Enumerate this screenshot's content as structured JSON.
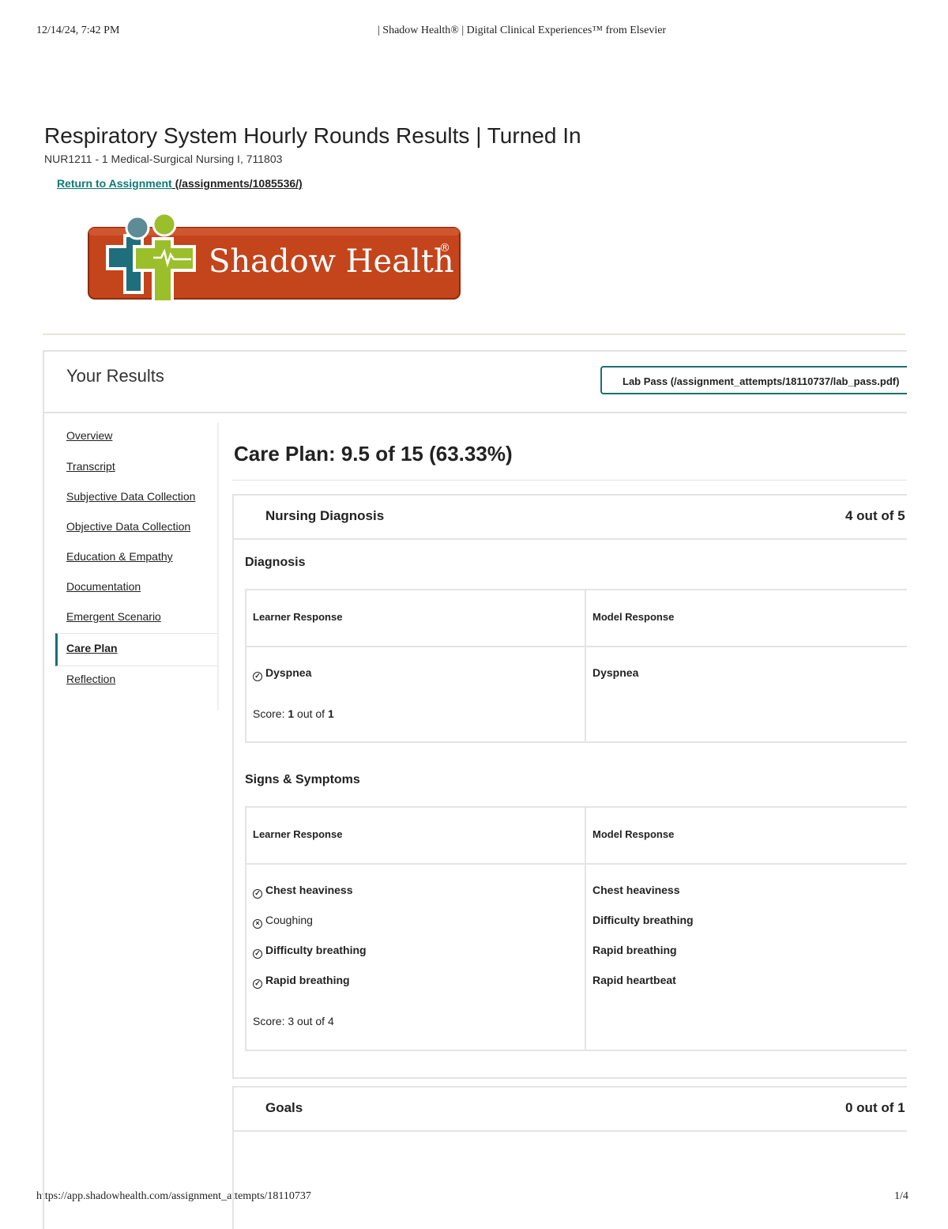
{
  "print_header": {
    "datetime": "12/14/24, 7:42 PM",
    "title": "| Shadow Health® | Digital Clinical Experiences™ from Elsevier"
  },
  "print_footer": {
    "url": "https://app.shadowhealth.com/assignment_attempts/18110737",
    "page": "1/4"
  },
  "page": {
    "title": "Respiratory System Hourly Rounds Results | Turned In",
    "course": "NUR1211 - 1 Medical-Surgical Nursing I, 711803",
    "return_label": "Return to Assignment",
    "return_path": " (/assignments/1085536/)"
  },
  "logo": {
    "text": "Shadow Health",
    "reg": "®",
    "colors": {
      "bg": "#c4441c",
      "figure_green": "#9bbf2a",
      "figure_teal": "#1f6e7c"
    }
  },
  "results": {
    "title": "Your Results",
    "lab_pass": "Lab Pass (/assignment_attempts/18110737/lab_pass.pdf)"
  },
  "sidebar": {
    "items": [
      {
        "label": "Overview",
        "active": false
      },
      {
        "label": "Transcript",
        "active": false
      },
      {
        "label": "Subjective Data Collection",
        "active": false
      },
      {
        "label": "Objective Data Collection",
        "active": false
      },
      {
        "label": "Education & Empathy",
        "active": false
      },
      {
        "label": "Documentation",
        "active": false
      },
      {
        "label": "Emergent Scenario",
        "active": false
      },
      {
        "label": "Care Plan",
        "active": true
      },
      {
        "label": "Reflection",
        "active": false
      }
    ]
  },
  "main": {
    "title": "Care Plan: 9.5 of 15 (63.33%)",
    "nursing_diagnosis": {
      "title": "Nursing Diagnosis",
      "score": "4 out of 5",
      "diagnosis": {
        "title": "Diagnosis",
        "learner_header": "Learner Response",
        "model_header": "Model Response",
        "learner": [
          {
            "text": "Dyspnea",
            "mark": "check"
          }
        ],
        "model": [
          "Dyspnea"
        ],
        "score_prefix": "Score: ",
        "score_value": "1",
        "score_mid": " out of ",
        "score_total": "1"
      },
      "signs": {
        "title": "Signs & Symptoms",
        "learner_header": "Learner Response",
        "model_header": "Model Response",
        "learner": [
          {
            "text": "Chest heaviness",
            "mark": "check"
          },
          {
            "text": "Coughing",
            "mark": "x"
          },
          {
            "text": "Difficulty breathing",
            "mark": "check"
          },
          {
            "text": "Rapid breathing",
            "mark": "check"
          }
        ],
        "model": [
          "Chest heaviness",
          "Difficulty breathing",
          "Rapid breathing",
          "Rapid heartbeat"
        ],
        "score": "Score: 3 out of 4"
      }
    },
    "goals": {
      "title": "Goals",
      "score": "0 out of 1"
    }
  }
}
